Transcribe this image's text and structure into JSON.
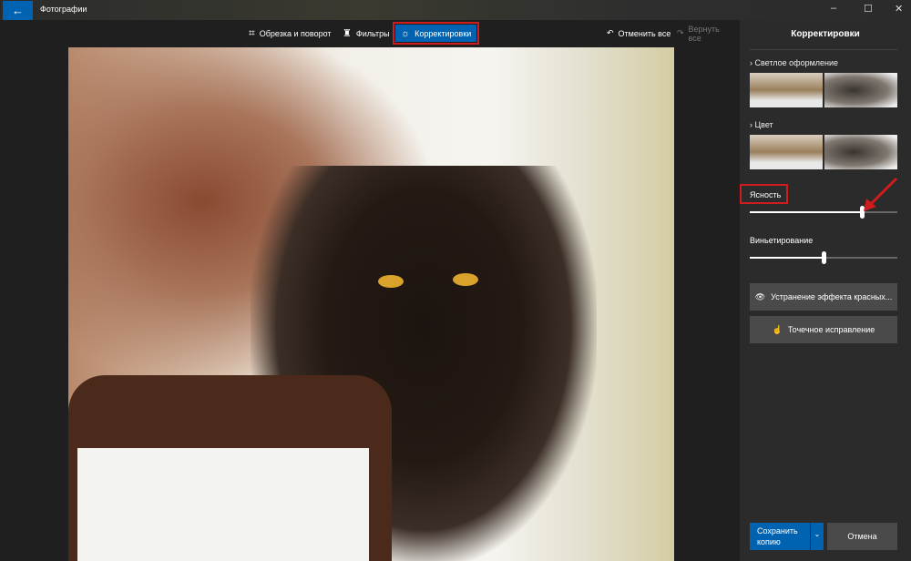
{
  "app": {
    "title": "Фотографии"
  },
  "toolbar": {
    "crop": "Обрезка и поворот",
    "filters": "Фильтры",
    "adjustments": "Корректировки",
    "undo_all": "Отменить все",
    "redo_all": "Вернуть все"
  },
  "panel": {
    "title": "Корректировки",
    "light": "Светлое оформление",
    "color": "Цвет",
    "clarity": {
      "label": "Ясность",
      "value_percent": 76
    },
    "vignette": {
      "label": "Виньетирование",
      "value_percent": 50
    },
    "red_eye": "Устранение эффекта красных...",
    "spot_fix": "Точечное исправление",
    "save_copy": "Сохранить копию",
    "cancel": "Отмена"
  },
  "colors": {
    "accent": "#0063b1",
    "highlight": "#d01c1c"
  }
}
